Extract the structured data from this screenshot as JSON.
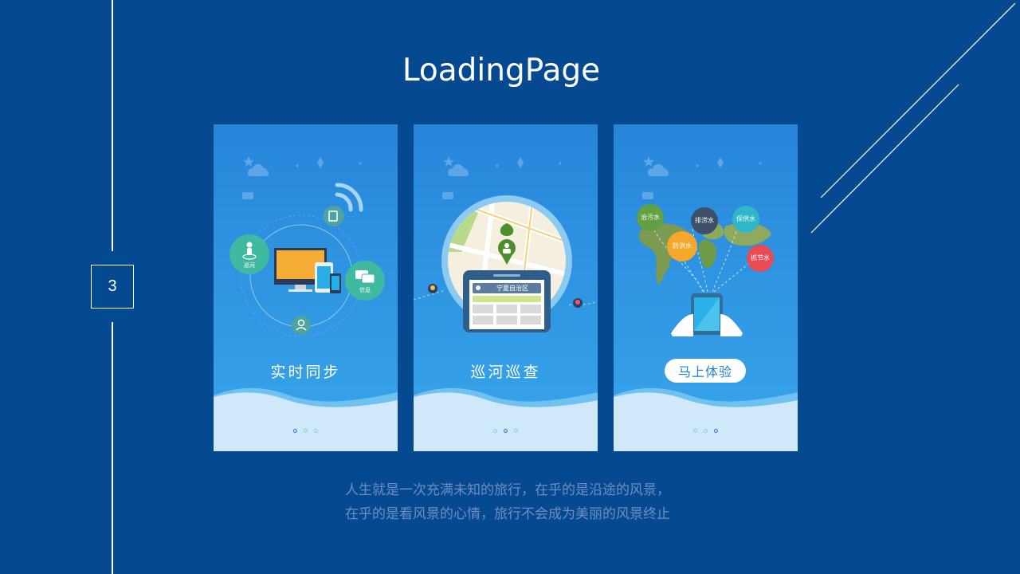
{
  "slide": {
    "page_number": "3",
    "title": "LoadingPage"
  },
  "screens": [
    {
      "label": "实时同步",
      "left_bubble": "巡河",
      "right_bubble": "信息",
      "active_dot": 0
    },
    {
      "label": "巡河巡查",
      "search_text": "宁夏自治区",
      "active_dot": 1
    },
    {
      "cta_label": "马上体验",
      "bubbles": [
        "治污水",
        "排涝水",
        "保供水",
        "防洪水",
        "抓节水"
      ],
      "active_dot": 2
    }
  ],
  "caption": {
    "line1": "人生就是一次充满未知的旅行，在乎的是沿途的风景，",
    "line2": "在乎的是看风景的心情，旅行不会成为美丽的风景终止"
  },
  "colors": {
    "background": "#054a91",
    "screen_top": "#2785da",
    "screen_bottom": "#38a6ea",
    "accent": "#1f7fd6"
  }
}
